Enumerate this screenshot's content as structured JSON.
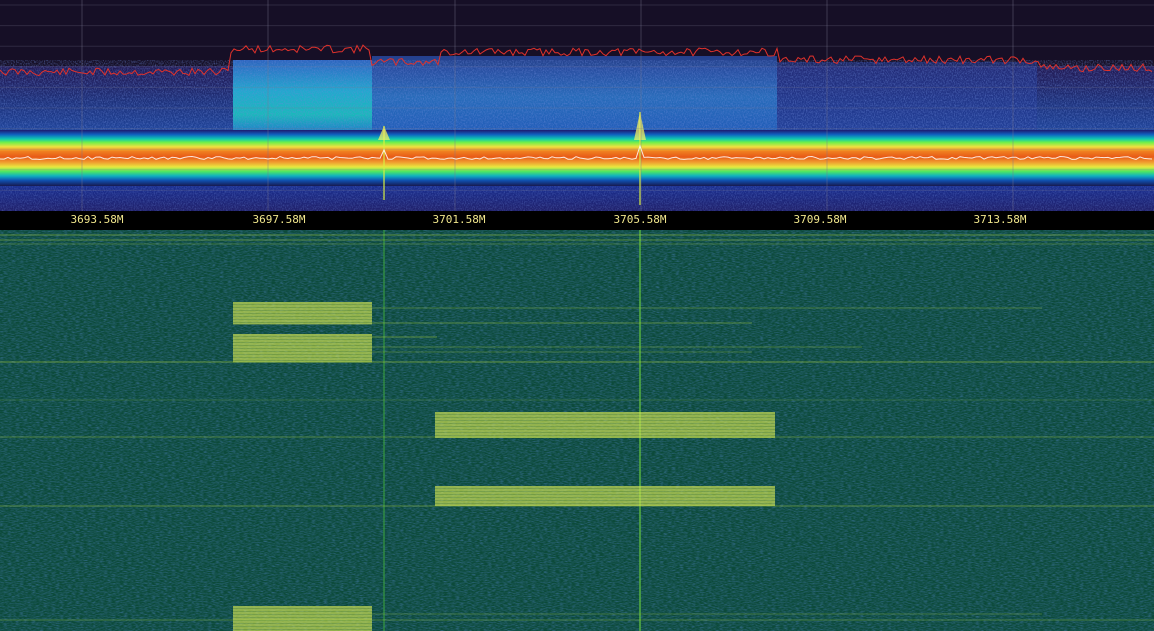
{
  "frequency_axis": {
    "labels": [
      "3693.58M",
      "3697.58M",
      "3701.58M",
      "3705.58M",
      "3709.58M",
      "3713.58M"
    ]
  },
  "colors": {
    "spectrum_background": "#160f26",
    "peak_trace": "#e0322c",
    "average_trace": "#ffffff",
    "axis_text": "#f0e68c",
    "waterfall_background": "#0c4a3a",
    "waterfall_burst": "#c8e04a"
  },
  "icons": []
}
